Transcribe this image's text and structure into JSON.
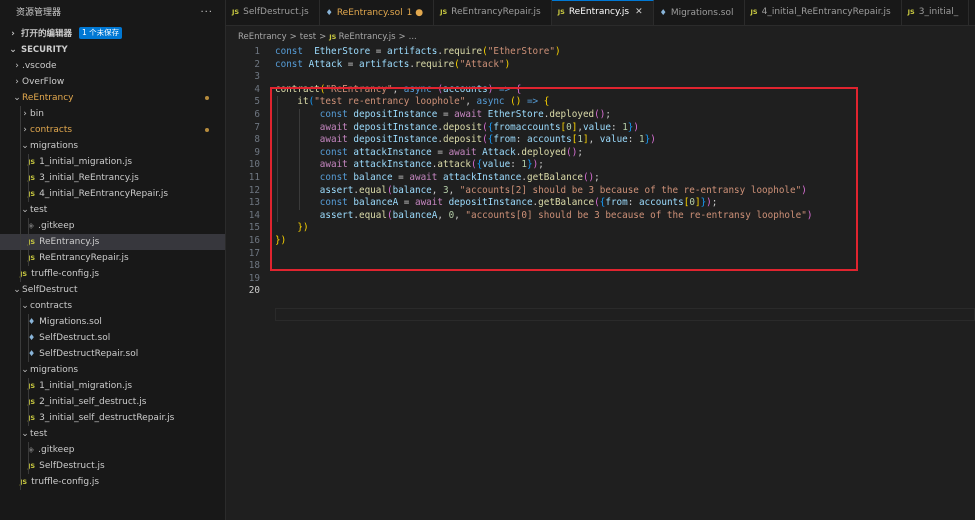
{
  "sidebar": {
    "title": "资源管理器",
    "more": "···",
    "open_editors": {
      "label": "打开的编辑器",
      "badge": "1 个未保存"
    },
    "root": "SECURITY",
    "items": [
      {
        "label": ".vscode",
        "depth": 1,
        "kind": "folder-closed"
      },
      {
        "label": "OverFlow",
        "depth": 1,
        "kind": "folder-closed"
      },
      {
        "label": "ReEntrancy",
        "depth": 1,
        "kind": "folder-open",
        "modified": true
      },
      {
        "label": "bin",
        "depth": 2,
        "kind": "folder-closed"
      },
      {
        "label": "contracts",
        "depth": 2,
        "kind": "folder-closed",
        "modified": true
      },
      {
        "label": "migrations",
        "depth": 2,
        "kind": "folder-open"
      },
      {
        "label": "1_initial_migration.js",
        "depth": 3,
        "kind": "js"
      },
      {
        "label": "3_initial_ReEntrancy.js",
        "depth": 3,
        "kind": "js"
      },
      {
        "label": "4_initial_ReEntrancyRepair.js",
        "depth": 3,
        "kind": "js"
      },
      {
        "label": "test",
        "depth": 2,
        "kind": "folder-open"
      },
      {
        "label": ".gitkeep",
        "depth": 3,
        "kind": "gitkeep"
      },
      {
        "label": "ReEntrancy.js",
        "depth": 3,
        "kind": "js",
        "selected": true
      },
      {
        "label": "ReEntrancyRepair.js",
        "depth": 3,
        "kind": "js"
      },
      {
        "label": "truffle-config.js",
        "depth": 2,
        "kind": "js"
      },
      {
        "label": "SelfDestruct",
        "depth": 1,
        "kind": "folder-open"
      },
      {
        "label": "contracts",
        "depth": 2,
        "kind": "folder-open"
      },
      {
        "label": "Migrations.sol",
        "depth": 3,
        "kind": "sol"
      },
      {
        "label": "SelfDestruct.sol",
        "depth": 3,
        "kind": "sol"
      },
      {
        "label": "SelfDestructRepair.sol",
        "depth": 3,
        "kind": "sol"
      },
      {
        "label": "migrations",
        "depth": 2,
        "kind": "folder-open"
      },
      {
        "label": "1_initial_migration.js",
        "depth": 3,
        "kind": "js"
      },
      {
        "label": "2_initial_self_destruct.js",
        "depth": 3,
        "kind": "js"
      },
      {
        "label": "3_initial_self_destructRepair.js",
        "depth": 3,
        "kind": "js"
      },
      {
        "label": "test",
        "depth": 2,
        "kind": "folder-open"
      },
      {
        "label": ".gitkeep",
        "depth": 3,
        "kind": "gitkeep"
      },
      {
        "label": "SelfDestruct.js",
        "depth": 3,
        "kind": "js"
      },
      {
        "label": "truffle-config.js",
        "depth": 2,
        "kind": "js"
      }
    ]
  },
  "tabs": [
    {
      "label": "SelfDestruct.js",
      "icon": "js"
    },
    {
      "label": "ReEntrancy.sol",
      "icon": "sol",
      "suffix": "1 ●",
      "modified": true
    },
    {
      "label": "ReEntrancyRepair.js",
      "icon": "js"
    },
    {
      "label": "ReEntrancy.js",
      "icon": "js",
      "active": true,
      "close": "✕"
    },
    {
      "label": "Migrations.sol",
      "icon": "sol"
    },
    {
      "label": "4_initial_ReEntrancyRepair.js",
      "icon": "js"
    },
    {
      "label": "3_initial_",
      "icon": "js"
    }
  ],
  "breadcrumb": [
    "ReEntrancy",
    "test",
    "ReEntrancy.js",
    "..."
  ],
  "editor": {
    "current_line": 20,
    "lines": [
      {
        "n": "1",
        "tokens": [
          [
            "k",
            "const"
          ],
          [
            "",
            "  "
          ],
          [
            "v",
            "EtherStore"
          ],
          [
            "",
            " = "
          ],
          [
            "v",
            "artifacts"
          ],
          [
            "",
            "."
          ],
          [
            "f",
            "require"
          ],
          [
            "y",
            "("
          ],
          [
            "s",
            "\"EtherStore\""
          ],
          [
            "y",
            ")"
          ]
        ]
      },
      {
        "n": "2",
        "tokens": [
          [
            "k",
            "const"
          ],
          [
            "",
            " "
          ],
          [
            "v",
            "Attack"
          ],
          [
            "",
            " = "
          ],
          [
            "v",
            "artifacts"
          ],
          [
            "",
            "."
          ],
          [
            "f",
            "require"
          ],
          [
            "y",
            "("
          ],
          [
            "s",
            "\"Attack\""
          ],
          [
            "y",
            ")"
          ]
        ]
      },
      {
        "n": "3",
        "tokens": []
      },
      {
        "n": "4",
        "tokens": [
          [
            "f",
            "contract"
          ],
          [
            "y",
            "("
          ],
          [
            "s",
            "\"ReEntrancy\""
          ],
          [
            "",
            ", "
          ],
          [
            "k",
            "async"
          ],
          [
            "",
            " "
          ],
          [
            "p",
            "("
          ],
          [
            "v",
            "accounts"
          ],
          [
            "p",
            ")"
          ],
          [
            "",
            " "
          ],
          [
            "k",
            "=>"
          ],
          [
            "",
            " "
          ],
          [
            "p",
            "{"
          ]
        ]
      },
      {
        "n": "5",
        "tokens": [
          [
            "",
            "    "
          ],
          [
            "f",
            "it"
          ],
          [
            "b",
            "("
          ],
          [
            "s",
            "\"test re-entrancy loophole\""
          ],
          [
            "",
            ", "
          ],
          [
            "k",
            "async"
          ],
          [
            "",
            " "
          ],
          [
            "y",
            "()"
          ],
          [
            "",
            " "
          ],
          [
            "k",
            "=>"
          ],
          [
            "",
            " "
          ],
          [
            "y",
            "{"
          ]
        ]
      },
      {
        "n": "6",
        "tokens": [
          [
            "",
            "        "
          ],
          [
            "k",
            "const"
          ],
          [
            "",
            " "
          ],
          [
            "v",
            "depositInstance"
          ],
          [
            "",
            " = "
          ],
          [
            "ctl",
            "await"
          ],
          [
            "",
            " "
          ],
          [
            "v",
            "EtherStore"
          ],
          [
            "",
            "."
          ],
          [
            "f",
            "deployed"
          ],
          [
            "p",
            "()"
          ],
          [
            "",
            ";"
          ]
        ]
      },
      {
        "n": "7",
        "tokens": [
          [
            "",
            "        "
          ],
          [
            "ctl",
            "await"
          ],
          [
            "",
            " "
          ],
          [
            "v",
            "depositInstance"
          ],
          [
            "",
            "."
          ],
          [
            "f",
            "deposit"
          ],
          [
            "p",
            "("
          ],
          [
            "b",
            "{"
          ],
          [
            "v",
            "from"
          ],
          [
            ": "
          ],
          [
            "v",
            "accounts"
          ],
          [
            "y",
            "["
          ],
          [
            "n",
            "0"
          ],
          [
            "y",
            "]"
          ],
          [
            "",
            ","
          ],
          [
            "v",
            "value"
          ],
          [
            "",
            ": "
          ],
          [
            "n",
            "1"
          ],
          [
            "b",
            "}"
          ],
          [
            "p",
            ")"
          ]
        ]
      },
      {
        "n": "8",
        "tokens": [
          [
            "",
            "        "
          ],
          [
            "ctl",
            "await"
          ],
          [
            "",
            " "
          ],
          [
            "v",
            "depositInstance"
          ],
          [
            "",
            "."
          ],
          [
            "f",
            "deposit"
          ],
          [
            "p",
            "("
          ],
          [
            "b",
            "{"
          ],
          [
            "v",
            "from"
          ],
          [
            "",
            ": "
          ],
          [
            "v",
            "accounts"
          ],
          [
            "y",
            "["
          ],
          [
            "n",
            "1"
          ],
          [
            "y",
            "]"
          ],
          [
            "",
            ", "
          ],
          [
            "v",
            "value"
          ],
          [
            "",
            ": "
          ],
          [
            "n",
            "1"
          ],
          [
            "b",
            "}"
          ],
          [
            "p",
            ")"
          ]
        ]
      },
      {
        "n": "9",
        "tokens": [
          [
            "",
            "        "
          ],
          [
            "k",
            "const"
          ],
          [
            "",
            " "
          ],
          [
            "v",
            "attackInstance"
          ],
          [
            "",
            " = "
          ],
          [
            "ctl",
            "await"
          ],
          [
            "",
            " "
          ],
          [
            "v",
            "Attack"
          ],
          [
            "",
            "."
          ],
          [
            "f",
            "deployed"
          ],
          [
            "p",
            "()"
          ],
          [
            "",
            ";"
          ]
        ]
      },
      {
        "n": "10",
        "tokens": [
          [
            "",
            "        "
          ],
          [
            "ctl",
            "await"
          ],
          [
            "",
            " "
          ],
          [
            "v",
            "attackInstance"
          ],
          [
            "",
            "."
          ],
          [
            "f",
            "attack"
          ],
          [
            "p",
            "("
          ],
          [
            "b",
            "{"
          ],
          [
            "v",
            "value"
          ],
          [
            "",
            ": "
          ],
          [
            "n",
            "1"
          ],
          [
            "b",
            "}"
          ],
          [
            "p",
            ")"
          ],
          [
            "",
            ";"
          ]
        ]
      },
      {
        "n": "11",
        "tokens": [
          [
            "",
            "        "
          ],
          [
            "k",
            "const"
          ],
          [
            "",
            " "
          ],
          [
            "v",
            "balance"
          ],
          [
            "",
            " = "
          ],
          [
            "ctl",
            "await"
          ],
          [
            "",
            " "
          ],
          [
            "v",
            "attackInstance"
          ],
          [
            "",
            "."
          ],
          [
            "f",
            "getBalance"
          ],
          [
            "p",
            "()"
          ],
          [
            "",
            ";"
          ]
        ]
      },
      {
        "n": "12",
        "tokens": [
          [
            "",
            "        "
          ],
          [
            "v",
            "assert"
          ],
          [
            "",
            "."
          ],
          [
            "f",
            "equal"
          ],
          [
            "p",
            "("
          ],
          [
            "v",
            "balance"
          ],
          [
            "",
            ", "
          ],
          [
            "n",
            "3"
          ],
          [
            "",
            ", "
          ],
          [
            "s",
            "\"accounts[2] should be 3 because of the re-entransy loophole\""
          ],
          [
            "p",
            ")"
          ]
        ]
      },
      {
        "n": "13",
        "tokens": [
          [
            "",
            "        "
          ],
          [
            "k",
            "const"
          ],
          [
            "",
            " "
          ],
          [
            "v",
            "balanceA"
          ],
          [
            "",
            " = "
          ],
          [
            "ctl",
            "await"
          ],
          [
            "",
            " "
          ],
          [
            "v",
            "depositInstance"
          ],
          [
            "",
            "."
          ],
          [
            "f",
            "getBalance"
          ],
          [
            "p",
            "("
          ],
          [
            "b",
            "{"
          ],
          [
            "v",
            "from"
          ],
          [
            "",
            ": "
          ],
          [
            "v",
            "accounts"
          ],
          [
            "y",
            "["
          ],
          [
            "n",
            "0"
          ],
          [
            "y",
            "]"
          ],
          [
            "b",
            "}"
          ],
          [
            "p",
            ")"
          ],
          [
            "",
            ";"
          ]
        ]
      },
      {
        "n": "14",
        "tokens": [
          [
            "",
            "        "
          ],
          [
            "v",
            "assert"
          ],
          [
            "",
            "."
          ],
          [
            "f",
            "equal"
          ],
          [
            "p",
            "("
          ],
          [
            "v",
            "balanceA"
          ],
          [
            "",
            ", "
          ],
          [
            "n",
            "0"
          ],
          [
            "",
            ", "
          ],
          [
            "s",
            "\"accounts[0] should be 3 because of the re-entransy loophole\""
          ],
          [
            "p",
            ")"
          ]
        ]
      },
      {
        "n": "15",
        "tokens": [
          [
            "",
            "    "
          ],
          [
            "y",
            "})"
          ]
        ]
      },
      {
        "n": "16",
        "tokens": [
          [
            "y",
            "})"
          ]
        ]
      },
      {
        "n": "17",
        "tokens": []
      },
      {
        "n": "18",
        "tokens": []
      },
      {
        "n": "19",
        "tokens": []
      },
      {
        "n": "20",
        "tokens": []
      }
    ]
  },
  "colors": {
    "highlight_box": "#e0242f",
    "accent": "#0078d4",
    "modified": "#e2a84e"
  }
}
